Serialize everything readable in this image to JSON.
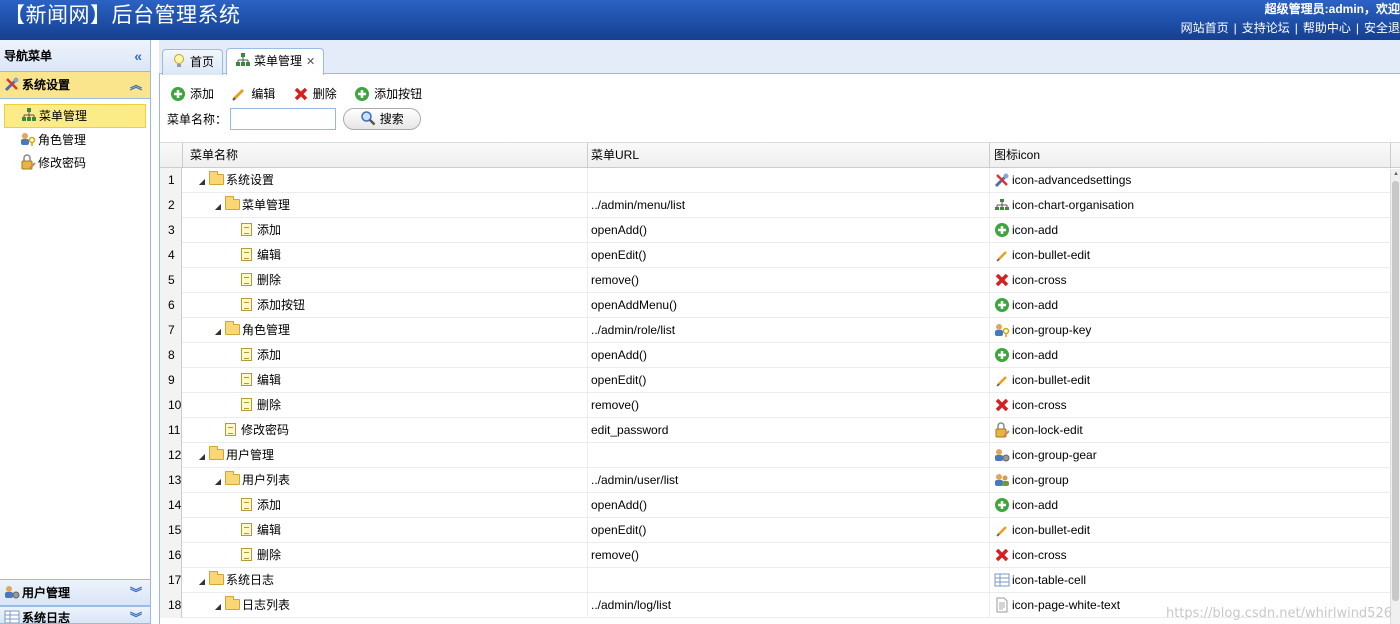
{
  "header": {
    "title": "【新闻网】后台管理系统",
    "welcome": "超级管理员:admin，欢迎",
    "links": [
      "网站首页",
      "支持论坛",
      "帮助中心",
      "安全退"
    ]
  },
  "nav": {
    "title": "导航菜单",
    "groups": [
      {
        "label": "系统设置",
        "icon": "tools-icon",
        "items": [
          {
            "label": "菜单管理",
            "icon": "org-chart-icon"
          },
          {
            "label": "角色管理",
            "icon": "group-key-icon"
          },
          {
            "label": "修改密码",
            "icon": "lock-edit-icon"
          }
        ]
      },
      {
        "label": "用户管理",
        "icon": "group-gear-icon"
      },
      {
        "label": "系统日志",
        "icon": "table-cell-icon"
      }
    ]
  },
  "tabs": [
    {
      "label": "首页",
      "icon": "bulb-icon"
    },
    {
      "label": "菜单管理",
      "icon": "org-chart-icon"
    }
  ],
  "toolbar": {
    "add": "添加",
    "edit": "编辑",
    "delete": "删除",
    "add_button": "添加按钮"
  },
  "search": {
    "label": "菜单名称：",
    "value": "",
    "button": "搜索"
  },
  "grid": {
    "columns": [
      "菜单名称",
      "菜单URL",
      "图标icon"
    ],
    "rows": [
      {
        "num": "1",
        "name": "系统设置",
        "url": "",
        "icon": "icon-advancedsettings"
      },
      {
        "num": "2",
        "name": "菜单管理",
        "url": "../admin/menu/list",
        "icon": "icon-chart-organisation"
      },
      {
        "num": "3",
        "name": "添加",
        "url": "openAdd()",
        "icon": "icon-add"
      },
      {
        "num": "4",
        "name": "编辑",
        "url": "openEdit()",
        "icon": "icon-bullet-edit"
      },
      {
        "num": "5",
        "name": "删除",
        "url": "remove()",
        "icon": "icon-cross"
      },
      {
        "num": "6",
        "name": "添加按钮",
        "url": "openAddMenu()",
        "icon": "icon-add"
      },
      {
        "num": "7",
        "name": "角色管理",
        "url": "../admin/role/list",
        "icon": "icon-group-key"
      },
      {
        "num": "8",
        "name": "添加",
        "url": "openAdd()",
        "icon": "icon-add"
      },
      {
        "num": "9",
        "name": "编辑",
        "url": "openEdit()",
        "icon": "icon-bullet-edit"
      },
      {
        "num": "10",
        "name": "删除",
        "url": "remove()",
        "icon": "icon-cross"
      },
      {
        "num": "11",
        "name": "修改密码",
        "url": "edit_password",
        "icon": "icon-lock-edit"
      },
      {
        "num": "12",
        "name": "用户管理",
        "url": "",
        "icon": "icon-group-gear"
      },
      {
        "num": "13",
        "name": "用户列表",
        "url": "../admin/user/list",
        "icon": "icon-group"
      },
      {
        "num": "14",
        "name": "添加",
        "url": "openAdd()",
        "icon": "icon-add"
      },
      {
        "num": "15",
        "name": "编辑",
        "url": "openEdit()",
        "icon": "icon-bullet-edit"
      },
      {
        "num": "16",
        "name": "删除",
        "url": "remove()",
        "icon": "icon-cross"
      },
      {
        "num": "17",
        "name": "系统日志",
        "url": "",
        "icon": "icon-table-cell"
      },
      {
        "num": "18",
        "name": "日志列表",
        "url": "../admin/log/list",
        "icon": "icon-page-white-text"
      }
    ]
  },
  "watermark": "https://blog.csdn.net/whirlwind526",
  "colors": {
    "header": "#1e4fa8",
    "selected": "#fbec88",
    "border": "#99bbe8"
  }
}
